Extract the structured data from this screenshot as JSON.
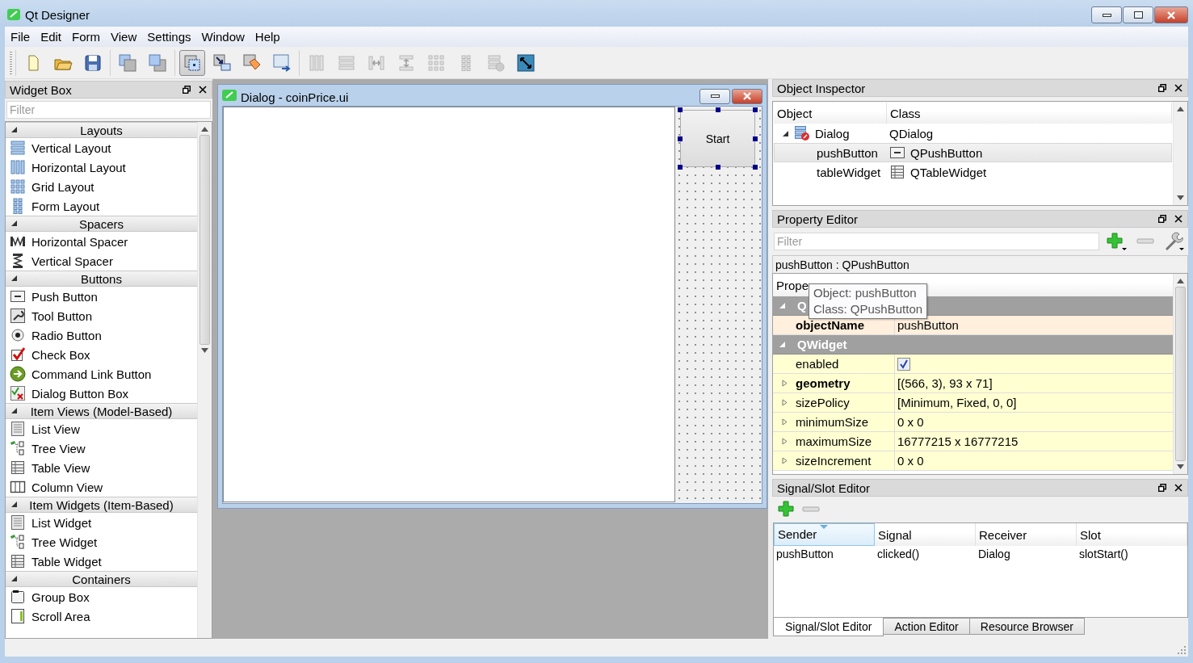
{
  "window": {
    "title": "Qt Designer"
  },
  "menu": [
    "File",
    "Edit",
    "Form",
    "View",
    "Settings",
    "Window",
    "Help"
  ],
  "toolbar": {
    "groups": [
      [
        {
          "kind": "new",
          "selected": false,
          "disabled": false
        },
        {
          "kind": "open",
          "selected": false,
          "disabled": false
        },
        {
          "kind": "save",
          "selected": false,
          "disabled": false
        }
      ],
      [
        {
          "kind": "send-back",
          "selected": false,
          "disabled": false
        },
        {
          "kind": "bring-front",
          "selected": false,
          "disabled": false
        }
      ],
      [
        {
          "kind": "edit-widgets",
          "selected": true,
          "disabled": false
        },
        {
          "kind": "signals-slots",
          "selected": false,
          "disabled": false
        },
        {
          "kind": "buddies",
          "selected": false,
          "disabled": false
        },
        {
          "kind": "tab-order",
          "selected": false,
          "disabled": false
        }
      ],
      [
        {
          "kind": "hlayout",
          "selected": false,
          "disabled": true
        },
        {
          "kind": "vlayout",
          "selected": false,
          "disabled": true
        },
        {
          "kind": "hsplitter",
          "selected": false,
          "disabled": true
        },
        {
          "kind": "vsplitter",
          "selected": false,
          "disabled": true
        },
        {
          "kind": "grid",
          "selected": false,
          "disabled": true
        },
        {
          "kind": "form",
          "selected": false,
          "disabled": true
        },
        {
          "kind": "break",
          "selected": false,
          "disabled": true
        },
        {
          "kind": "adjust",
          "selected": false,
          "disabled": false
        }
      ]
    ]
  },
  "widget_box": {
    "title": "Widget Box",
    "filter": {
      "placeholder": "Filter"
    },
    "categories": [
      {
        "name": "Layouts",
        "expanded": true,
        "items": [
          {
            "name": "Vertical Layout",
            "kind": "vlayout"
          },
          {
            "name": "Horizontal Layout",
            "kind": "hlayout"
          },
          {
            "name": "Grid Layout",
            "kind": "grid"
          },
          {
            "name": "Form Layout",
            "kind": "form"
          }
        ]
      },
      {
        "name": "Spacers",
        "expanded": true,
        "items": [
          {
            "name": "Horizontal Spacer",
            "kind": "hspacer"
          },
          {
            "name": "Vertical Spacer",
            "kind": "vspacer"
          }
        ]
      },
      {
        "name": "Buttons",
        "expanded": true,
        "items": [
          {
            "name": "Push Button",
            "kind": "pushbutton"
          },
          {
            "name": "Tool Button",
            "kind": "toolbutton"
          },
          {
            "name": "Radio Button",
            "kind": "radio"
          },
          {
            "name": "Check Box",
            "kind": "checkbox"
          },
          {
            "name": "Command Link Button",
            "kind": "commandlink"
          },
          {
            "name": "Dialog Button Box",
            "kind": "buttonbox"
          }
        ]
      },
      {
        "name": "Item Views (Model-Based)",
        "expanded": true,
        "items": [
          {
            "name": "List View",
            "kind": "list"
          },
          {
            "name": "Tree View",
            "kind": "tree"
          },
          {
            "name": "Table View",
            "kind": "table"
          },
          {
            "name": "Column View",
            "kind": "column"
          }
        ]
      },
      {
        "name": "Item Widgets (Item-Based)",
        "expanded": true,
        "items": [
          {
            "name": "List Widget",
            "kind": "list"
          },
          {
            "name": "Tree Widget",
            "kind": "tree"
          },
          {
            "name": "Table Widget",
            "kind": "table"
          }
        ]
      },
      {
        "name": "Containers",
        "expanded": true,
        "items": [
          {
            "name": "Group Box",
            "kind": "groupbox"
          },
          {
            "name": "Scroll Area",
            "kind": "scrollarea"
          }
        ]
      }
    ]
  },
  "form_window": {
    "title": "Dialog - coinPrice.ui",
    "button": {
      "label": "Start",
      "selected": true
    }
  },
  "object_inspector": {
    "title": "Object Inspector",
    "columns": [
      "Object",
      "Class"
    ],
    "tree": [
      {
        "object": "Dialog",
        "class": "QDialog",
        "kind": "dialog",
        "expanded": true,
        "selected": false,
        "children": [
          {
            "object": "pushButton",
            "class": "QPushButton",
            "kind": "pushbutton",
            "selected": true
          },
          {
            "object": "tableWidget",
            "class": "QTableWidget",
            "kind": "table",
            "selected": false
          }
        ]
      }
    ]
  },
  "property_editor": {
    "title": "Property Editor",
    "filter": {
      "placeholder": "Filter"
    },
    "object_label": "pushButton : QPushButton",
    "columns": [
      "Prope"
    ],
    "tooltip": [
      "Object: pushButton",
      "Class: QPushButton"
    ],
    "groups": [
      {
        "name": "Q",
        "color": "#ffefdc",
        "expanded": true,
        "rows": [
          {
            "name": "objectName",
            "kind": "text",
            "value": "pushButton",
            "modified": true,
            "expandable": false
          }
        ]
      },
      {
        "name": "QWidget",
        "color": "#ffffd2",
        "expanded": true,
        "rows": [
          {
            "name": "enabled",
            "kind": "checkbox",
            "checked": true,
            "modified": false,
            "expandable": false
          },
          {
            "name": "geometry",
            "kind": "text",
            "value": "[(566, 3), 93 x 71]",
            "modified": true,
            "expandable": true
          },
          {
            "name": "sizePolicy",
            "kind": "text",
            "value": "[Minimum, Fixed, 0, 0]",
            "modified": false,
            "expandable": true
          },
          {
            "name": "minimumSize",
            "kind": "text",
            "value": "0 x 0",
            "modified": false,
            "expandable": true
          },
          {
            "name": "maximumSize",
            "kind": "text",
            "value": "16777215 x 16777215",
            "modified": false,
            "expandable": true
          },
          {
            "name": "sizeIncrement",
            "kind": "text",
            "value": "0 x 0",
            "modified": false,
            "expandable": true
          }
        ]
      }
    ]
  },
  "signal_slot_editor": {
    "title": "Signal/Slot Editor",
    "columns": [
      {
        "label": "Sender",
        "sorted": true
      },
      {
        "label": "Signal",
        "sorted": false
      },
      {
        "label": "Receiver",
        "sorted": false
      },
      {
        "label": "Slot",
        "sorted": false
      }
    ],
    "rows": [
      [
        "pushButton",
        "clicked()",
        "Dialog",
        "slotStart()"
      ]
    ]
  },
  "bottom_tabs": [
    {
      "label": "Signal/Slot Editor",
      "selected": true
    },
    {
      "label": "Action Editor",
      "selected": false
    },
    {
      "label": "Resource Browser",
      "selected": false
    }
  ]
}
